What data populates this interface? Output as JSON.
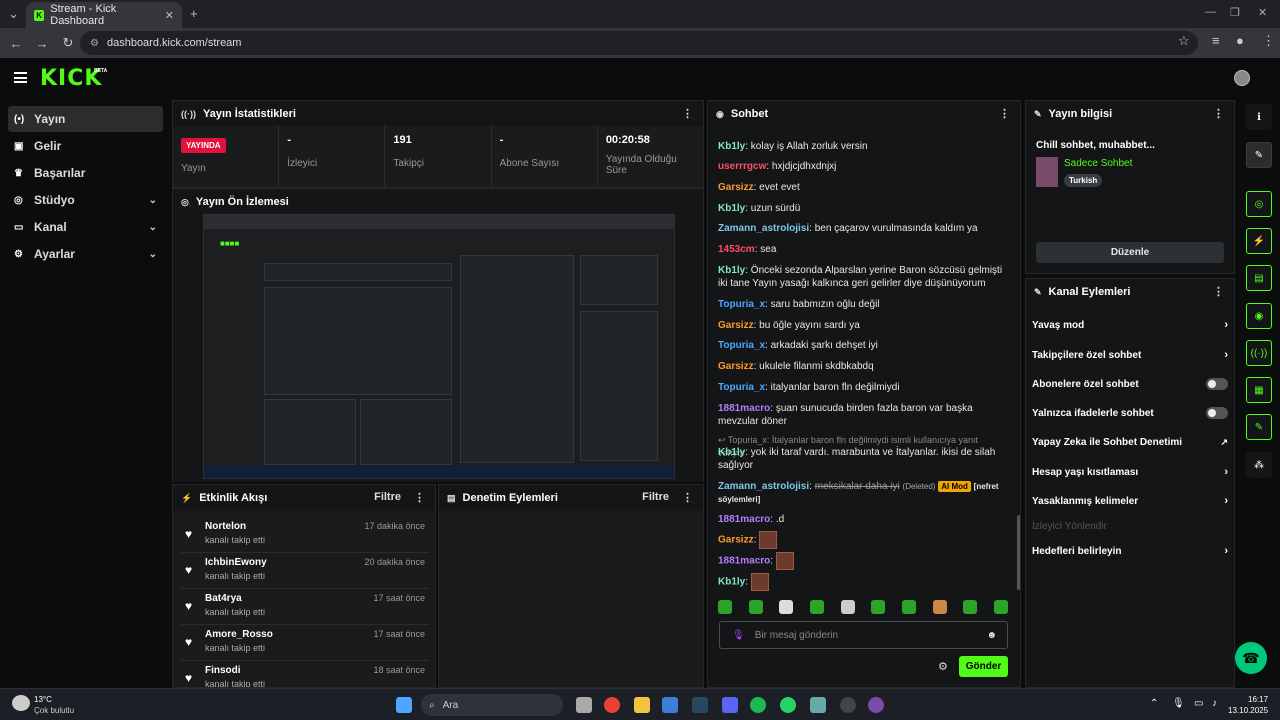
{
  "browser": {
    "tab_title": "Stream - Kick Dashboard",
    "url": "dashboard.kick.com/stream",
    "new_tab": "+",
    "tab_favicon": "K"
  },
  "brand": {
    "logo": "KICK",
    "beta": "BETA"
  },
  "sidebar": {
    "items": [
      {
        "label": "Yayın",
        "icon": "broadcast-icon",
        "active": true
      },
      {
        "label": "Gelir",
        "icon": "chart-icon"
      },
      {
        "label": "Başarılar",
        "icon": "trophy-icon"
      },
      {
        "label": "Stüdyo",
        "icon": "studio-icon",
        "expandable": true
      },
      {
        "label": "Kanal",
        "icon": "channel-icon",
        "expandable": true
      },
      {
        "label": "Ayarlar",
        "icon": "gear-icon",
        "expandable": true
      }
    ]
  },
  "stats_panel": {
    "title": "Yayın İstatistikleri",
    "stats": [
      {
        "value": "YAYINDA",
        "label": "Yayın"
      },
      {
        "value": "-",
        "label": "İzleyici"
      },
      {
        "value": "191",
        "label": "Takipçi"
      },
      {
        "value": "-",
        "label": "Abone Sayısı"
      },
      {
        "value": "00:20:58",
        "label": "Yayında Olduğu Süre"
      }
    ]
  },
  "preview_panel": {
    "title": "Yayın Ön İzlemesi"
  },
  "activity": {
    "title": "Etkinlik Akışı",
    "filter": "Filtre",
    "items": [
      {
        "name": "Nortelon",
        "action": "kanalı takip etti",
        "time": "17 dakika önce"
      },
      {
        "name": "IchbinEwony",
        "action": "kanalı takip etti",
        "time": "20 dakika önce"
      },
      {
        "name": "Bat4rya",
        "action": "kanalı takip etti",
        "time": "17 saat önce"
      },
      {
        "name": "Amore_Rosso",
        "action": "kanalı takip etti",
        "time": "17 saat önce"
      },
      {
        "name": "Finsodi",
        "action": "kanalı takip etti",
        "time": "18 saat önce"
      }
    ]
  },
  "mod_actions": {
    "title": "Denetim Eylemleri",
    "filter": "Filtre"
  },
  "chat": {
    "title": "Sohbet",
    "placeholder": "Bir mesaj gönderin",
    "send": "Gönder",
    "reply_hint": "Topuria_x: İtalyanlar baron fln değilmiydi isimli kullanıcıya yanıt veriyor",
    "deleted_label": "(Deleted)",
    "mod_tag": "AI Mod",
    "mod_reason": "[nefret söylemleri]",
    "messages": [
      {
        "user": "Kb1ly",
        "color": "#7ee8c8",
        "text": "kolay iş Allah zorluk versin"
      },
      {
        "user": "userrrgcw",
        "color": "#ff4d6d",
        "text": "hxjdjcjdhxdnjxj"
      },
      {
        "user": "Garsizz",
        "color": "#ff9a2e",
        "text": "evet evet"
      },
      {
        "user": "Kb1ly",
        "color": "#7ee8c8",
        "text": "uzun sürdü"
      },
      {
        "user": "Zamann_astrolojisi",
        "color": "#7ec8e8",
        "text": "ben çaçarov vurulmasında kaldım ya"
      },
      {
        "user": "1453cm",
        "color": "#ff4d6d",
        "text": "sea"
      },
      {
        "user": "Kb1ly",
        "color": "#7ee8c8",
        "text": "Önceki sezonda Alparslan yerine Baron sözcüsü gelmişti iki tane Yayın yasağı kalkınca geri gelirler diye düşünüyorum"
      },
      {
        "user": "Topuria_x",
        "color": "#4aa8ff",
        "text": "saru babmızın oğlu değil"
      },
      {
        "user": "Garsizz",
        "color": "#ff9a2e",
        "text": "bu öğle yayını sardı ya"
      },
      {
        "user": "Topuria_x",
        "color": "#4aa8ff",
        "text": "arkadaki şarkı dehşet iyi"
      },
      {
        "user": "Garsizz",
        "color": "#ff9a2e",
        "text": "ukulele filanmi skdbkabdq"
      },
      {
        "user": "Topuria_x",
        "color": "#4aa8ff",
        "text": "italyanlar baron fln değilmiydi"
      },
      {
        "user": "1881macro",
        "color": "#b77dff",
        "text": "şuan sunucuda birden fazla baron var başka mevzular döner"
      },
      {
        "user": "Kb1ly",
        "color": "#7ee8c8",
        "text": "yok iki taraf vardı. marabunta ve İtalyanlar. ikisi de silah sağlıyor"
      },
      {
        "user": "Zamann_astrolojisi",
        "color": "#7ec8e8",
        "text": "meksikalar daha iyi"
      },
      {
        "user": "1881macro",
        "color": "#b77dff",
        "text": ".d"
      },
      {
        "user": "Garsizz",
        "color": "#ff9a2e",
        "text": ""
      },
      {
        "user": "1881macro",
        "color": "#b77dff",
        "text": ""
      },
      {
        "user": "Kb1ly",
        "color": "#7ee8c8",
        "text": ""
      }
    ]
  },
  "stream_info": {
    "title": "Yayın bilgisi",
    "stream_title": "Chill sohbet, muhabbet...",
    "category": "Sadece Sohbet",
    "tag": "Turkish",
    "edit": "Düzenle"
  },
  "channel_actions": {
    "title": "Kanal Eylemleri",
    "items": [
      {
        "label": "Yavaş mod",
        "type": "chevron"
      },
      {
        "label": "Takipçilere özel sohbet",
        "type": "chevron"
      },
      {
        "label": "Abonelere özel sohbet",
        "type": "toggle"
      },
      {
        "label": "Yalnızca ifadelerle sohbet",
        "type": "toggle"
      },
      {
        "label": "Yapay Zeka ile Sohbet Denetimi",
        "type": "external"
      },
      {
        "label": "Hesap yaşı kısıtlaması",
        "type": "chevron"
      },
      {
        "label": "Yasaklanmış kelimeler",
        "type": "chevron"
      },
      {
        "label": "İzleyici Yönlendir",
        "type": "disabled"
      },
      {
        "label": "Hedefleri belirleyin",
        "type": "chevron"
      }
    ]
  },
  "taskbar": {
    "weather_temp": "13°C",
    "weather_desc": "Çok bulutlu",
    "search": "Ara",
    "time": "16:17",
    "date": "13.10.2025"
  },
  "colors": {
    "accent": "#53fc18",
    "live": "#e2123d"
  }
}
